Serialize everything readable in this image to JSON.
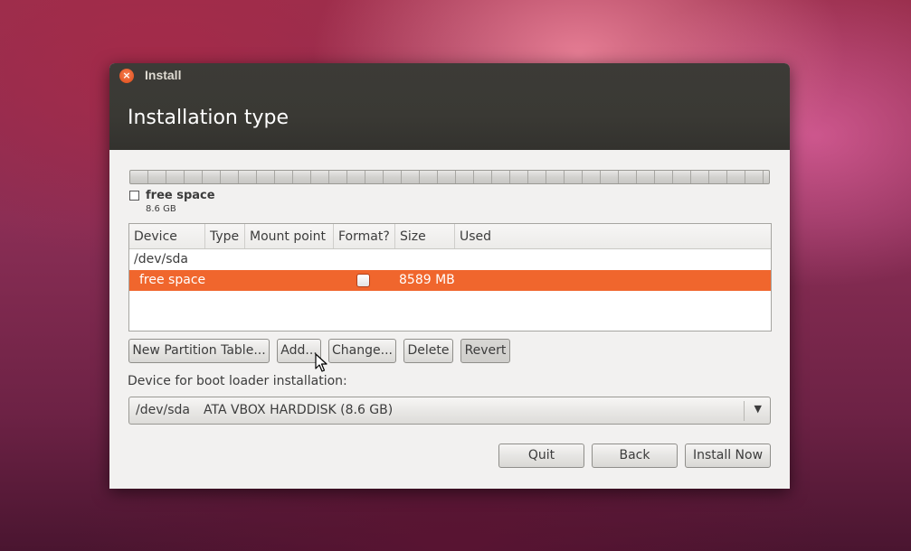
{
  "window": {
    "title": "Install",
    "close_glyph": "×",
    "page_title": "Installation type"
  },
  "partition_legend": {
    "label": "free space",
    "size": "8.6 GB"
  },
  "table": {
    "columns": [
      "Device",
      "Type",
      "Mount point",
      "Format?",
      "Size",
      "Used"
    ],
    "rows": [
      {
        "device": "/dev/sda",
        "type": "",
        "mount": "",
        "format": "",
        "size": "",
        "used": ""
      },
      {
        "device": "free space",
        "type": "",
        "mount": "",
        "format": "unchecked",
        "size": "8589 MB",
        "used": "",
        "selected": true
      }
    ]
  },
  "buttons": {
    "new_partition_table": "New Partition Table...",
    "add": "Add...",
    "change": "Change...",
    "delete": "Delete",
    "revert": "Revert"
  },
  "boot_loader": {
    "label": "Device for boot loader installation:",
    "device": "/dev/sda",
    "description": "ATA VBOX HARDDISK (8.6 GB)"
  },
  "footer": {
    "quit": "Quit",
    "back": "Back",
    "install_now": "Install Now"
  },
  "colors": {
    "accent": "#f0662d",
    "titlebar": "#3c3b37",
    "close": "#df4a16"
  },
  "icons": {
    "close": "close-icon",
    "dropdown": "chevron-down-icon",
    "cursor": "mouse-pointer-icon"
  }
}
